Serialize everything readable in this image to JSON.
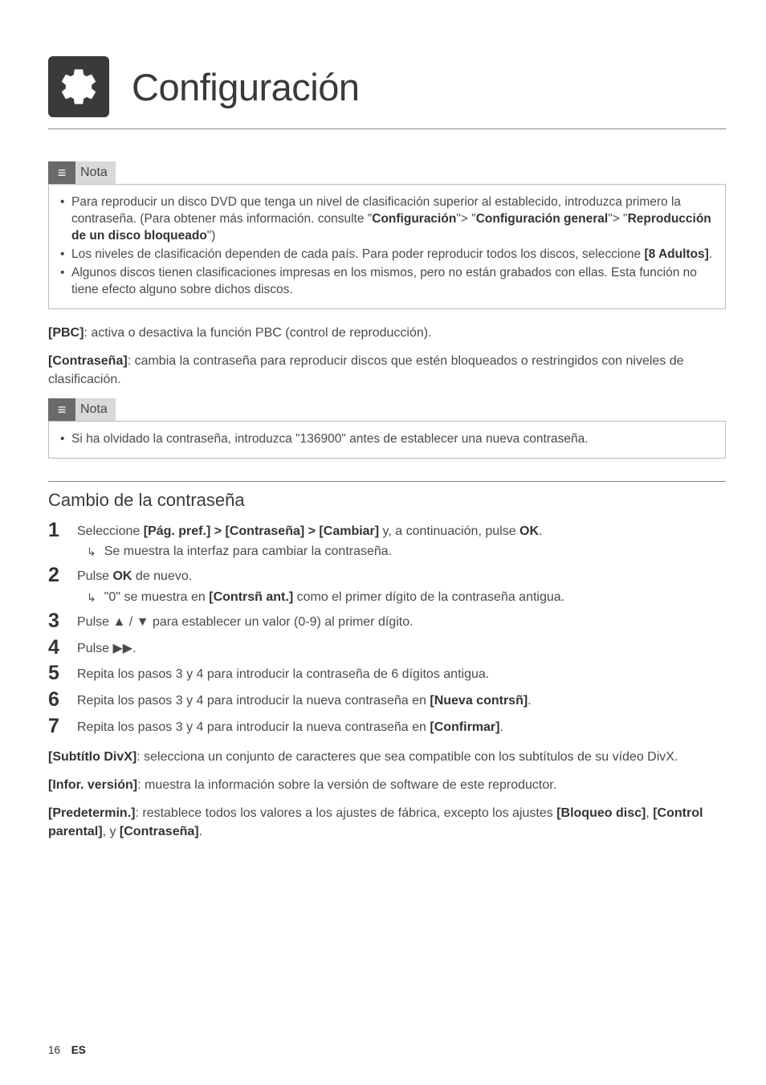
{
  "header": {
    "title": "Configuración"
  },
  "note1": {
    "label": "Nota",
    "items": [
      {
        "pre": "Para reproducir un disco DVD que tenga un nivel de clasificación superior al establecido, introduzca primero la contraseña. (Para obtener más información. consulte \"",
        "b1": "Configuración",
        "mid1": "\"> \"",
        "b2": "Configuración general",
        "mid2": "\"> \"",
        "b3": "Reproducción de un disco bloqueado",
        "post": "\")"
      },
      {
        "pre": "Los niveles de clasificación dependen de cada país. Para poder reproducir todos los discos, seleccione ",
        "b1": "[8 Adultos]",
        "post": "."
      },
      {
        "pre": "Algunos discos tienen clasificaciones impresas en los mismos, pero no están grabados con ellas. Esta función no tiene efecto alguno sobre dichos discos."
      }
    ]
  },
  "paras": {
    "pbc_label": "[PBC]",
    "pbc_text": ": activa o desactiva la función PBC (control de reproducción).",
    "contra_label": "[Contraseña]",
    "contra_text": ": cambia la contraseña para reproducir discos que estén bloqueados o restringidos con niveles de clasificación."
  },
  "note2": {
    "label": "Nota",
    "items": [
      {
        "pre": "Si ha olvidado la contraseña, introduzca \"136900\" antes de establecer una nueva contraseña."
      }
    ]
  },
  "section": {
    "heading": "Cambio de la contraseña"
  },
  "steps": {
    "n1": "1",
    "n2": "2",
    "n3": "3",
    "n4": "4",
    "n5": "5",
    "n6": "6",
    "n7": "7",
    "s1a": "Seleccione ",
    "s1b": "[Pág. pref.] > [Contraseña] > [Cambiar]",
    "s1c": " y, a continuación, pulse ",
    "s1d": "OK",
    "s1e": ".",
    "s1r": "Se muestra la interfaz para cambiar la contraseña.",
    "s2a": "Pulse ",
    "s2b": "OK",
    "s2c": " de nuevo.",
    "s2r1": "\"0\" se muestra en ",
    "s2r2": "[Contrsñ ant.]",
    "s2r3": " como el primer dígito de la contraseña antigua.",
    "s3a": "Pulse ",
    "s3b": " para establecer un valor (0-9) al primer dígito.",
    "s4a": "Pulse ",
    "s4b": ".",
    "s5": "Repita los pasos 3 y 4 para introducir la contraseña de 6 dígitos antigua.",
    "s6a": "Repita los pasos 3 y 4 para introducir la nueva contraseña en ",
    "s6b": "[Nueva contrsñ]",
    "s6c": ".",
    "s7a": "Repita los pasos 3 y 4 para introducir la nueva contraseña en ",
    "s7b": "[Confirmar]",
    "s7c": "."
  },
  "tail": {
    "divx_label": "[Subtítlo DivX]",
    "divx_text": ": selecciona un conjunto de caracteres que sea compatible con los subtítulos de su vídeo DivX.",
    "ver_label": "[Infor. versión]",
    "ver_text": ": muestra la información sobre la versión de software de este reproductor.",
    "def_label": "[Predetermin.]",
    "def_text1": ": restablece todos los valores a los ajustes de fábrica, excepto los ajustes ",
    "def_b1": "[Bloqueo disc]",
    "def_mid1": ", ",
    "def_b2": "[Control parental]",
    "def_mid2": ", y ",
    "def_b3": "[Contraseña]",
    "def_post": "."
  },
  "footer": {
    "page": "16",
    "lang": "ES"
  }
}
